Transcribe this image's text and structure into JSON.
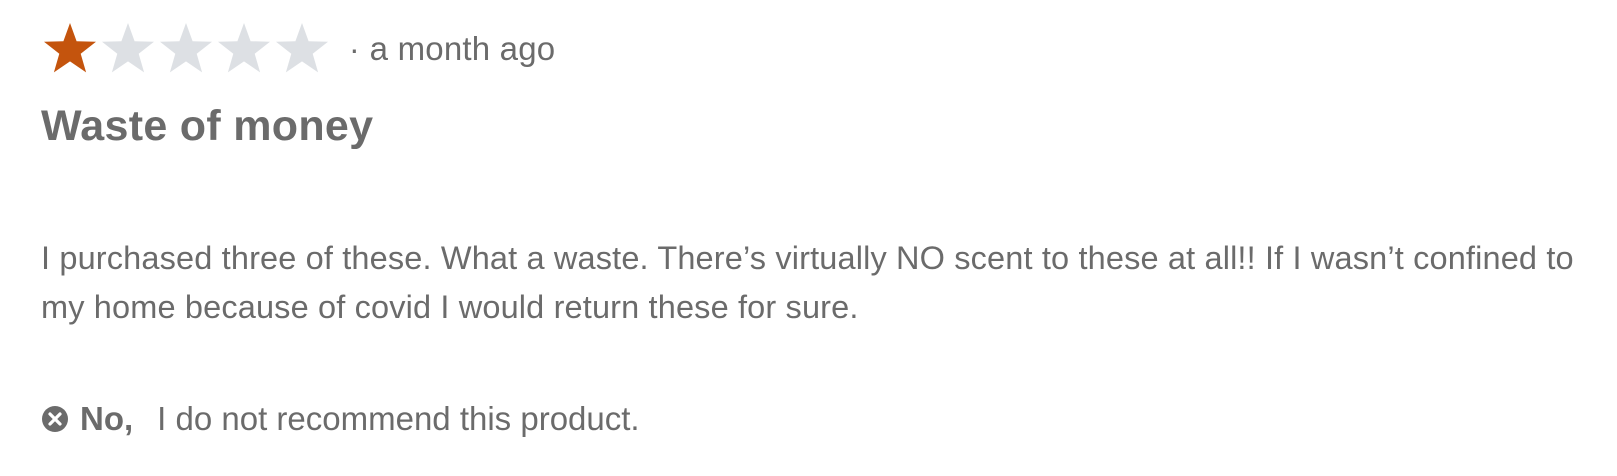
{
  "review": {
    "rating": 1,
    "max_rating": 5,
    "separator": "·",
    "time_ago": "a month ago",
    "title": "Waste of money",
    "body": "I purchased three of these. What a waste. There’s virtually NO scent to these at all!! If I wasn’t confined to my home because of covid I would return these for sure.",
    "recommend": {
      "answer": "No,",
      "statement": "I do not recommend this product.",
      "icon": "x-circle-icon"
    }
  },
  "colors": {
    "star_filled": "#c4540d",
    "star_empty": "#dde0e4",
    "text": "#6b6b6b"
  }
}
